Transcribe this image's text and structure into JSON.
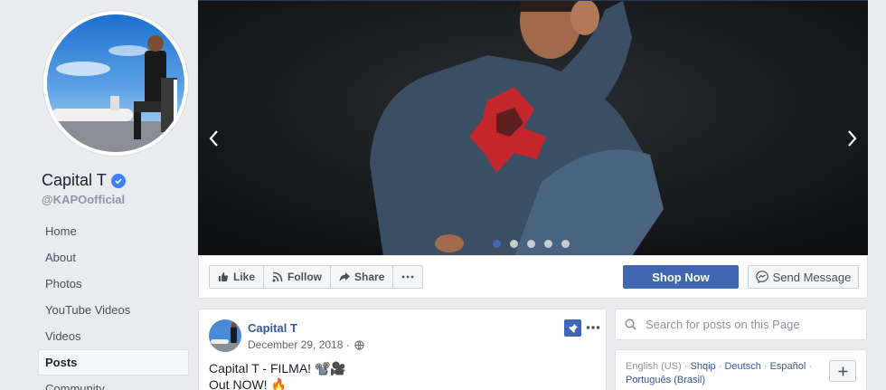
{
  "page": {
    "name": "Capital T",
    "username": "@KAPOofficial"
  },
  "nav": [
    "Home",
    "About",
    "Photos",
    "YouTube Videos",
    "Videos",
    "Posts",
    "Community"
  ],
  "nav_active_index": 5,
  "cover": {
    "slides": 5,
    "active_slide": 1
  },
  "actions": {
    "like": "Like",
    "follow": "Follow",
    "share": "Share",
    "shop_now": "Shop Now",
    "send_message": "Send Message"
  },
  "post": {
    "author": "Capital T",
    "date": "December 29, 2018 · ",
    "line1": "Capital T - FILMA! 📽️🎥",
    "line2": "Out NOW! 🔥"
  },
  "search": {
    "placeholder": "Search for posts on this Page"
  },
  "languages": {
    "current": "English (US)",
    "others": [
      "Shqip",
      "Deutsch",
      "Español",
      "Português (Brasil)"
    ]
  },
  "colors": {
    "brand": "#4267b2",
    "link": "#365899",
    "verified": "#4080ff"
  },
  "icons": [
    "verified-badge-icon",
    "like-icon",
    "follow-icon",
    "share-icon",
    "more-icon",
    "messenger-icon",
    "pin-icon",
    "globe-icon",
    "search-icon",
    "plus-icon",
    "chevron-left-icon",
    "chevron-right-icon"
  ]
}
